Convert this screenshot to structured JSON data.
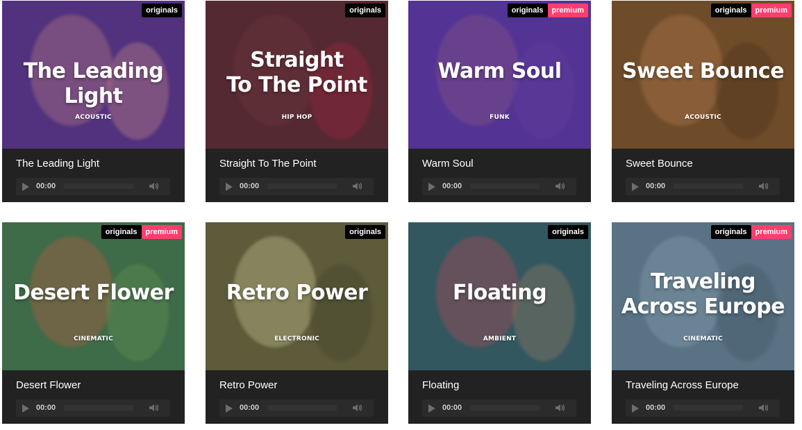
{
  "cards": [
    {
      "title": "The Leading Light",
      "art_lines": [
        "The Leading Light"
      ],
      "genre": "ACOUSTIC",
      "time": "00:00",
      "badges": [
        "originals"
      ],
      "colors": {
        "bg": "#4b2a5a",
        "tint": "rgba(90,60,170,0.45)",
        "s1": "#c9845c",
        "s2": "#e6a063"
      }
    },
    {
      "title": "Straight To The Point",
      "art_lines": [
        "Straight",
        "To The Point"
      ],
      "genre": "HIP HOP",
      "time": "00:00",
      "badges": [
        "originals"
      ],
      "colors": {
        "bg": "#5a2a2a",
        "tint": "rgba(80,40,60,0.45)",
        "s1": "#7a3b3b",
        "s2": "#c0283a"
      }
    },
    {
      "title": "Warm Soul",
      "art_lines": [
        "Warm Soul"
      ],
      "genre": "FUNK",
      "time": "00:00",
      "badges": [
        "originals",
        "premium"
      ],
      "colors": {
        "bg": "#4a2c80",
        "tint": "rgba(95,60,170,0.45)",
        "s1": "#8e5d6f",
        "s2": "#5b3c90"
      }
    },
    {
      "title": "Sweet Bounce",
      "art_lines": [
        "Sweet Bounce"
      ],
      "genre": "ACOUSTIC",
      "time": "00:00",
      "badges": [
        "originals",
        "premium"
      ],
      "colors": {
        "bg": "#6b4a2a",
        "tint": "rgba(120,80,40,0.35)",
        "s1": "#b07a52",
        "s2": "#3e2a1a"
      }
    },
    {
      "title": "Desert Flower",
      "art_lines": [
        "Desert Flower"
      ],
      "genre": "CINEMATIC",
      "time": "00:00",
      "badges": [
        "originals",
        "premium"
      ],
      "colors": {
        "bg": "#3f6a4a",
        "tint": "rgba(60,110,70,0.35)",
        "s1": "#c45a45",
        "s2": "#6f9a5a"
      }
    },
    {
      "title": "Retro Power",
      "art_lines": [
        "Retro Power"
      ],
      "genre": "ELECTRONIC",
      "time": "00:00",
      "badges": [
        "originals"
      ],
      "colors": {
        "bg": "#5a5638",
        "tint": "rgba(100,100,60,0.35)",
        "s1": "#cfc79a",
        "s2": "#3b3a28"
      }
    },
    {
      "title": "Floating",
      "art_lines": [
        "Floating"
      ],
      "genre": "AMBIENT",
      "time": "00:00",
      "badges": [
        "originals"
      ],
      "colors": {
        "bg": "#2e5058",
        "tint": "rgba(60,100,110,0.35)",
        "s1": "#b8434e",
        "s2": "#a27a5a"
      }
    },
    {
      "title": "Traveling Across Europe",
      "art_lines": [
        "Traveling",
        "Across Europe"
      ],
      "genre": "CINEMATIC",
      "time": "00:00",
      "badges": [
        "originals",
        "premium"
      ],
      "colors": {
        "bg": "#5a7080",
        "tint": "rgba(90,120,140,0.35)",
        "s1": "#8aa0b0",
        "s2": "#40505a"
      }
    }
  ]
}
